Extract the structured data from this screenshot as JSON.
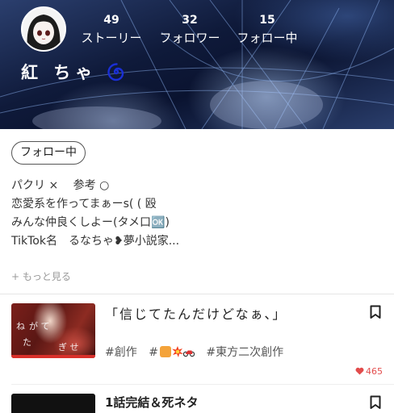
{
  "profile": {
    "username": "紅 ちゃ",
    "username_emoji": "cyclone-icon",
    "follow_button_label": "フォロー中",
    "stats": [
      {
        "count": "49",
        "label": "ストーリー"
      },
      {
        "count": "32",
        "label": "フォロワー"
      },
      {
        "count": "15",
        "label": "フォロー中"
      }
    ],
    "bio_lines": [
      "パクリ ×　 参考 ○",
      "恋愛系を作ってまぁーs( ( 殴",
      "みんな仲良くしよー(タメ口🆗)",
      "TikTok名　るなちゃ❥夢小説家..."
    ],
    "more_link": "+ もっと見る"
  },
  "stories": [
    {
      "title": "「信じてたんだけどなぁ、」",
      "tags": [
        "#創作",
        "#",
        "#東方二次創作"
      ],
      "tag_emojis": [
        "fist-icon",
        "collision-icon",
        "motorcycle-icon"
      ],
      "likes": "465",
      "thumbnail_text": [
        "ね",
        "が て",
        "た ",
        "ぎ せ"
      ]
    },
    {
      "title": "1話完結＆死ネタ"
    }
  ],
  "colors": {
    "likes": "#e24c4c",
    "banner_dark": "#0f1a3a",
    "swirl": "#1a2fd6"
  }
}
